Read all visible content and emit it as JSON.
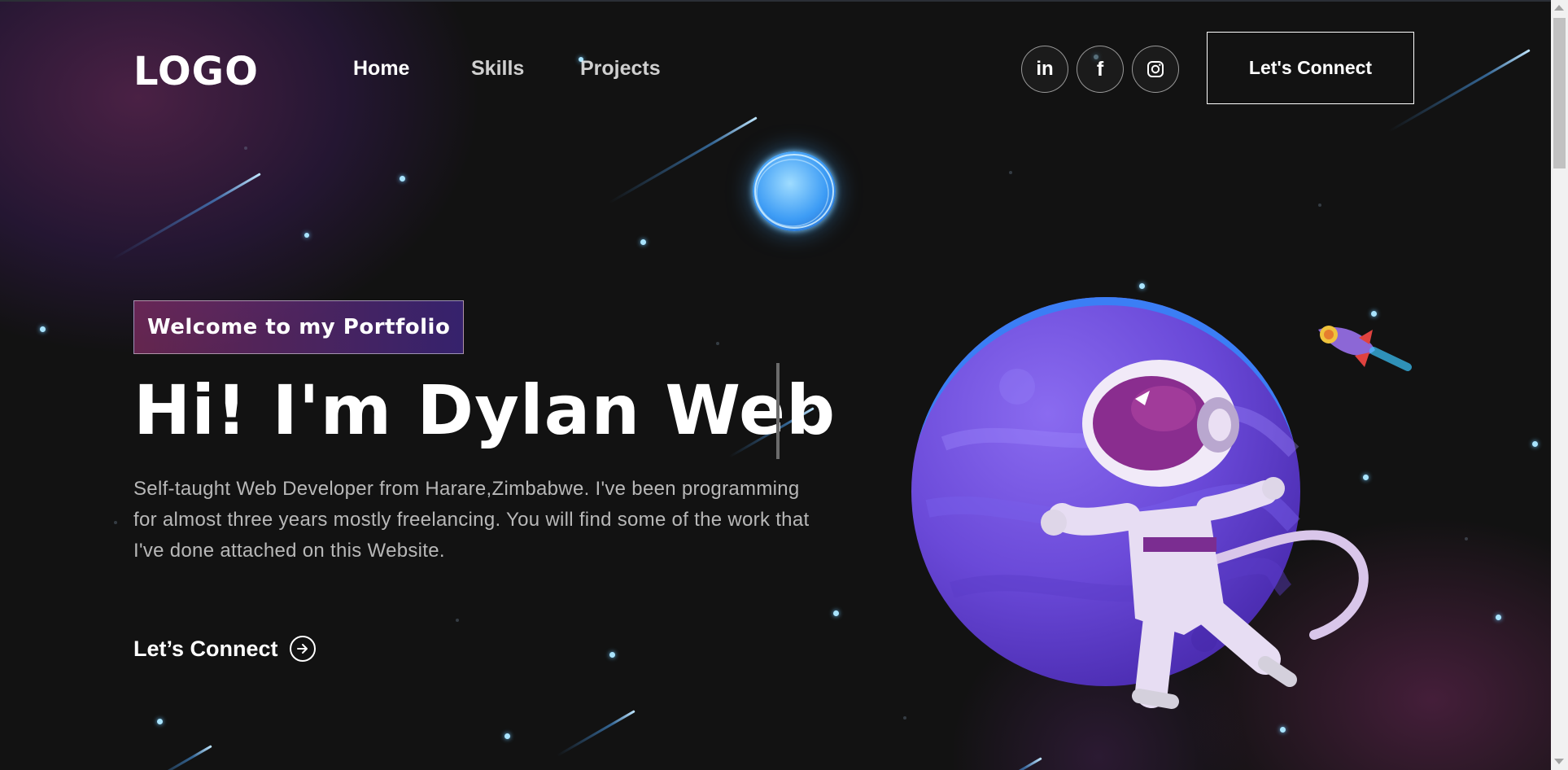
{
  "nav": {
    "logo": "LOGO",
    "links": [
      {
        "label": "Home"
      },
      {
        "label": "Skills"
      },
      {
        "label": "Projects"
      }
    ],
    "social": [
      {
        "label": "in",
        "icon": "linkedin-icon"
      },
      {
        "label": "f",
        "icon": "facebook-icon"
      },
      {
        "label": "",
        "icon": "instagram-icon"
      }
    ],
    "connect_label": "Let's Connect"
  },
  "hero": {
    "tagline": "Welcome to my Portfolio",
    "title": "Hi! I'm Dylan Web",
    "description": "Self-taught Web Developer from Harare,Zimbabwe. I've been programming for almost three years mostly freelancing. You will find some of the work that I've done attached on this Website.",
    "connect_label": "Let’s Connect",
    "connect_icon": "arrow-right-circle-icon"
  },
  "colors": {
    "background": "#121212",
    "tagline_gradient_start": "#aa367c",
    "tagline_gradient_end": "#4a2fbd",
    "planet": "#6a49d8",
    "star": "#a9e4ff"
  }
}
